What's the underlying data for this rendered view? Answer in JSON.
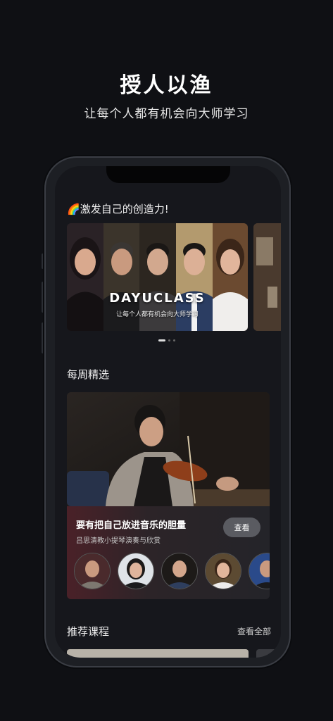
{
  "hero": {
    "title": "授人以渔",
    "subtitle": "让每个人都有机会向大师学习"
  },
  "app": {
    "banner_section": {
      "emoji": "🌈",
      "title": "激发自己的创造力!",
      "brand": "DAYUCLASS",
      "slogan": "让每个人都有机会向大师学习",
      "pages": 3,
      "active_page": 1
    },
    "weekly": {
      "title": "每周精选",
      "course_title": "要有把自己放进音乐的胆量",
      "course_subtitle": "吕思清教小提琴演奏与欣赏",
      "view_button": "查看"
    },
    "recommended": {
      "title": "推荐课程",
      "see_all": "查看全部"
    }
  },
  "colors": {
    "background": "#0f1014",
    "screen": "#16171c",
    "card_gradient_start": "#4a2128",
    "button": "#5a5b61"
  }
}
